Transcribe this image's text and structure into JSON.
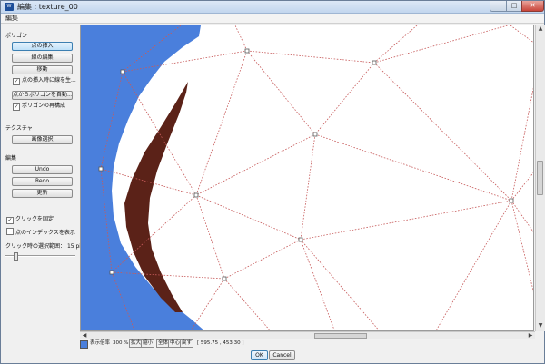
{
  "window": {
    "title": "編集 : texture_00",
    "app_icon": "app-icon",
    "minimize": "─",
    "maximize": "□",
    "close": "✕"
  },
  "menu": {
    "edit": "編集"
  },
  "panel": {
    "polygon_section": "ポリゴン",
    "insert_point": "点の挿入",
    "edit_line": "線の編集",
    "move": "移動",
    "auto_generate_on_insert": "点の挿入時に線を生...",
    "auto_polygon_from_points": "点からポリゴンを自動...",
    "rebuild_polygon": "ポリゴンの再構成",
    "texture_section": "テクスチャ",
    "select_image": "画像選択",
    "edit_section": "編集",
    "undo": "Undo",
    "redo": "Redo",
    "update": "更新",
    "fix_click": "クリックを固定",
    "show_point_index": "点のインデックスを表示",
    "click_range_label": "クリック時の選択範囲：",
    "click_range_value": "15 pi..."
  },
  "checkbox_states": {
    "auto_generate_on_insert": true,
    "rebuild_polygon": true,
    "fix_click": true,
    "show_point_index": false
  },
  "status": {
    "zoom_label": "表示倍率",
    "zoom_value": "300 %",
    "zoom_in": "拡大",
    "zoom_out": "縮小",
    "fit_all": "全体",
    "center": "中心",
    "reset": "戻す",
    "coords": "[ 595.75 , 453.30 ]"
  },
  "dialog": {
    "ok": "OK",
    "cancel": "Cancel"
  },
  "colors": {
    "background_blue": "#4a7fdc",
    "stroke_brown": "#5b2218",
    "mesh_line": "#c75b5b"
  },
  "scroll": {
    "horizontal_position": 0.52,
    "vertical_position": 0.45
  }
}
